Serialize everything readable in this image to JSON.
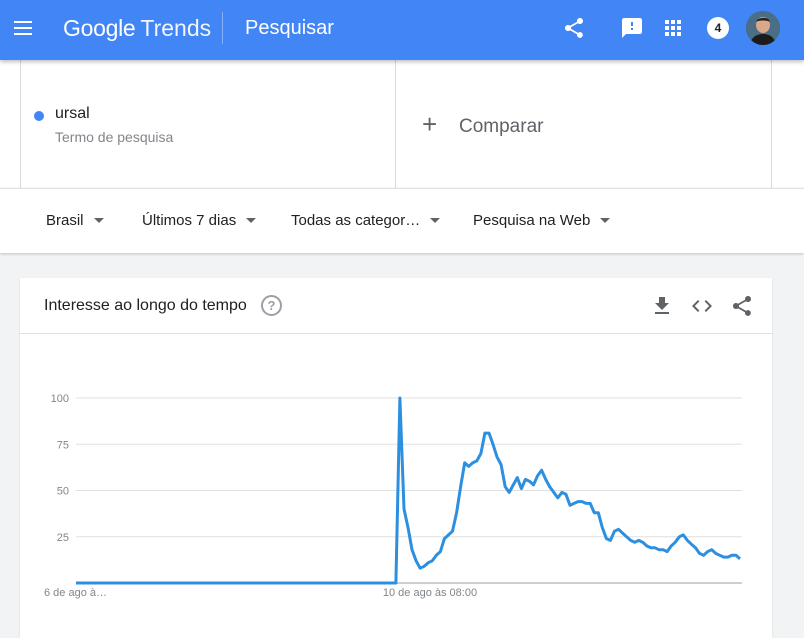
{
  "header": {
    "brand_google": "Google",
    "brand_trends": "Trends",
    "page_title": "Pesquisar",
    "notification_count": "4",
    "color": "#4285f4"
  },
  "terms": [
    {
      "name": "ursal",
      "subtitle": "Termo de pesquisa",
      "color": "#4285f4"
    }
  ],
  "compare": {
    "plus": "+",
    "label": "Comparar"
  },
  "filters": {
    "region": "Brasil",
    "period": "Últimos 7 dias",
    "category": "Todas as categor…",
    "search_type": "Pesquisa na Web"
  },
  "card": {
    "title": "Interesse ao longo do tempo",
    "help_glyph": "?"
  },
  "chart_data": {
    "type": "line",
    "title": "Interesse ao longo do tempo",
    "x_labels": [
      "6 de ago à…",
      "10 de ago às 08:00"
    ],
    "ylim": [
      0,
      100
    ],
    "y_ticks": [
      25,
      50,
      75,
      100
    ],
    "grid": true,
    "series": [
      {
        "color": "#2d8fe0",
        "values": [
          0,
          0,
          0,
          0,
          0,
          0,
          0,
          0,
          0,
          0,
          0,
          0,
          0,
          0,
          0,
          0,
          0,
          0,
          0,
          0,
          0,
          0,
          0,
          0,
          0,
          0,
          0,
          0,
          0,
          0,
          0,
          0,
          0,
          0,
          0,
          0,
          0,
          0,
          0,
          0,
          0,
          0,
          0,
          0,
          0,
          0,
          0,
          0,
          0,
          0,
          0,
          0,
          0,
          0,
          0,
          0,
          0,
          0,
          0,
          0,
          0,
          0,
          0,
          0,
          0,
          0,
          0,
          0,
          0,
          0,
          0,
          0,
          0,
          0,
          0,
          0,
          0,
          0,
          0,
          0,
          100,
          40,
          30,
          18,
          12,
          8,
          9,
          11,
          12,
          15,
          17,
          24,
          26,
          28,
          38,
          52,
          65,
          63,
          65,
          66,
          70,
          81,
          81,
          75,
          68,
          64,
          52,
          49,
          53,
          57,
          51,
          56,
          55,
          53,
          58,
          61,
          56,
          52,
          49,
          46,
          49,
          48,
          42,
          43,
          44,
          44,
          43,
          43,
          38,
          38,
          30,
          24,
          23,
          28,
          29,
          27,
          25,
          23,
          22,
          23,
          22,
          20,
          19,
          19,
          18,
          18,
          17,
          20,
          22,
          25,
          26,
          23,
          21,
          19,
          16,
          15,
          17,
          18,
          16,
          15,
          14,
          14,
          15,
          15,
          13
        ]
      }
    ]
  }
}
